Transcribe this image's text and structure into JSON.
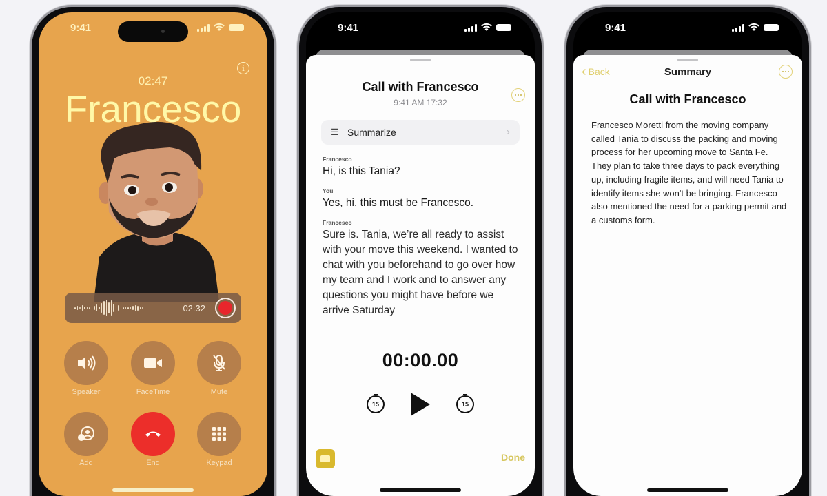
{
  "phones": {
    "call": {
      "status_time": "9:41",
      "elapsed": "02:47",
      "caller": "Francesco",
      "recording": {
        "time": "02:32"
      },
      "controls": [
        {
          "label": "Speaker",
          "icon": "speaker-icon"
        },
        {
          "label": "FaceTime",
          "icon": "video-icon"
        },
        {
          "label": "Mute",
          "icon": "mic-slash-icon"
        },
        {
          "label": "Add",
          "icon": "add-person-icon"
        },
        {
          "label": "End",
          "icon": "end-call-icon"
        },
        {
          "label": "Keypad",
          "icon": "keypad-icon"
        }
      ],
      "colors": {
        "background": "#e7a44d",
        "end": "#ec2e2a",
        "record": "#e8262c"
      }
    },
    "transcript": {
      "status_time": "9:41",
      "title": "Call with Francesco",
      "subtitle": "9:41 AM  17:32",
      "summarize_label": "Summarize",
      "messages": [
        {
          "speaker": "Francesco",
          "text": "Hi, is this Tania?"
        },
        {
          "speaker": "You",
          "text": "Yes, hi, this must be Francesco."
        },
        {
          "speaker": "Francesco",
          "text": "Sure is. Tania, we’re all ready to assist with your move this weekend. I wanted to chat with you beforehand to go over how my team and I work and to answer any questions you might have before we arrive Saturday"
        }
      ],
      "timer": "00:00.00",
      "skip_back": "15",
      "skip_forward": "15",
      "done_label": "Done",
      "accent": "#d9b92e"
    },
    "summary": {
      "status_time": "9:41",
      "back_label": "Back",
      "nav_title": "Summary",
      "title": "Call with Francesco",
      "body": "Francesco Moretti from the moving company called Tania to discuss the packing and moving process for her upcoming move to Santa Fe. They plan to take three days to pack everything up, including fragile items, and will need Tania to identify items she won't be bringing. Francesco also mentioned the need for a parking permit and a customs form."
    }
  }
}
